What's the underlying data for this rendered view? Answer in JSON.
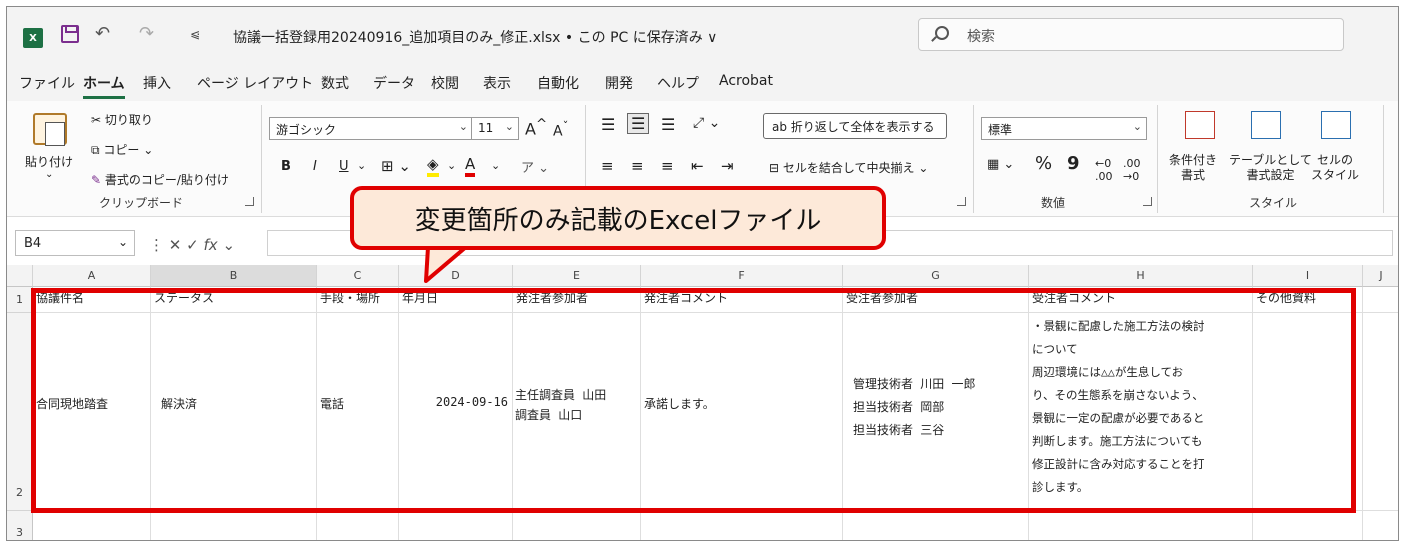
{
  "titlebar": {
    "app_icon": "X",
    "qat_label": "⩿",
    "title": "協議一括登録用20240916_追加項目のみ_修正.xlsx • この PC に保存済み ∨",
    "search_placeholder": "検索"
  },
  "menu": [
    "ファイル",
    "ホーム",
    "挿入",
    "ページ レイアウト",
    "数式",
    "データ",
    "校閲",
    "表示",
    "自動化",
    "開発",
    "ヘルプ",
    "Acrobat"
  ],
  "ribbon": {
    "paste": "貼り付け",
    "cut": "切り取り",
    "copy": "コピー",
    "format_painter": "書式のコピー/貼り付け",
    "clipboard_group": "クリップボード",
    "font_name": "游ゴシック",
    "font_size": "11",
    "bold": "B",
    "italic": "I",
    "underline": "U",
    "wrap_text": "折り返して全体を表示する",
    "merge_center": "セルを結合して中央揃え",
    "number_format": "標準",
    "number_group": "数値",
    "cond_format": "条件付き\n書式",
    "table_format": "テーブルとして\n書式設定",
    "cell_style": "セルの\nスタイル",
    "style_group": "スタイル"
  },
  "formula_bar": {
    "name_box": "B4",
    "fx": "fx"
  },
  "callout": "変更箇所のみ記載のExcelファイル",
  "columns": [
    "A",
    "B",
    "C",
    "D",
    "E",
    "F",
    "G",
    "H",
    "I",
    "J"
  ],
  "rows": [
    "1",
    "2",
    "3"
  ],
  "header_row": [
    "協議件名",
    "ステータス",
    "手段・場所",
    "年月日",
    "発注者参加者",
    "発注者コメント",
    "受注者参加者",
    "受注者コメント",
    "その他資料"
  ],
  "data_row": {
    "a": "合同現地踏査",
    "b": "解決済",
    "c": "電話",
    "d": "2024-09-16",
    "e": [
      "主任調査員 山田",
      "調査員 山口"
    ],
    "f": "承諾します。",
    "g": [
      "管理技術者 川田 一郎",
      "担当技術者 岡部",
      "担当技術者 三谷"
    ],
    "h": [
      "・景観に配慮した施工方法の検討",
      "について",
      "周辺環境には△△が生息してお",
      "り、その生態系を崩さないよう、",
      "景観に一定の配慮が必要であると",
      "判断します。施工方法についても",
      "修正設計に含み対応することを打",
      "診します。"
    ],
    "i": ""
  },
  "colors": {
    "accent": "#1d7044",
    "highlight": "#e00000",
    "callout_fill": "#fde9d9"
  }
}
